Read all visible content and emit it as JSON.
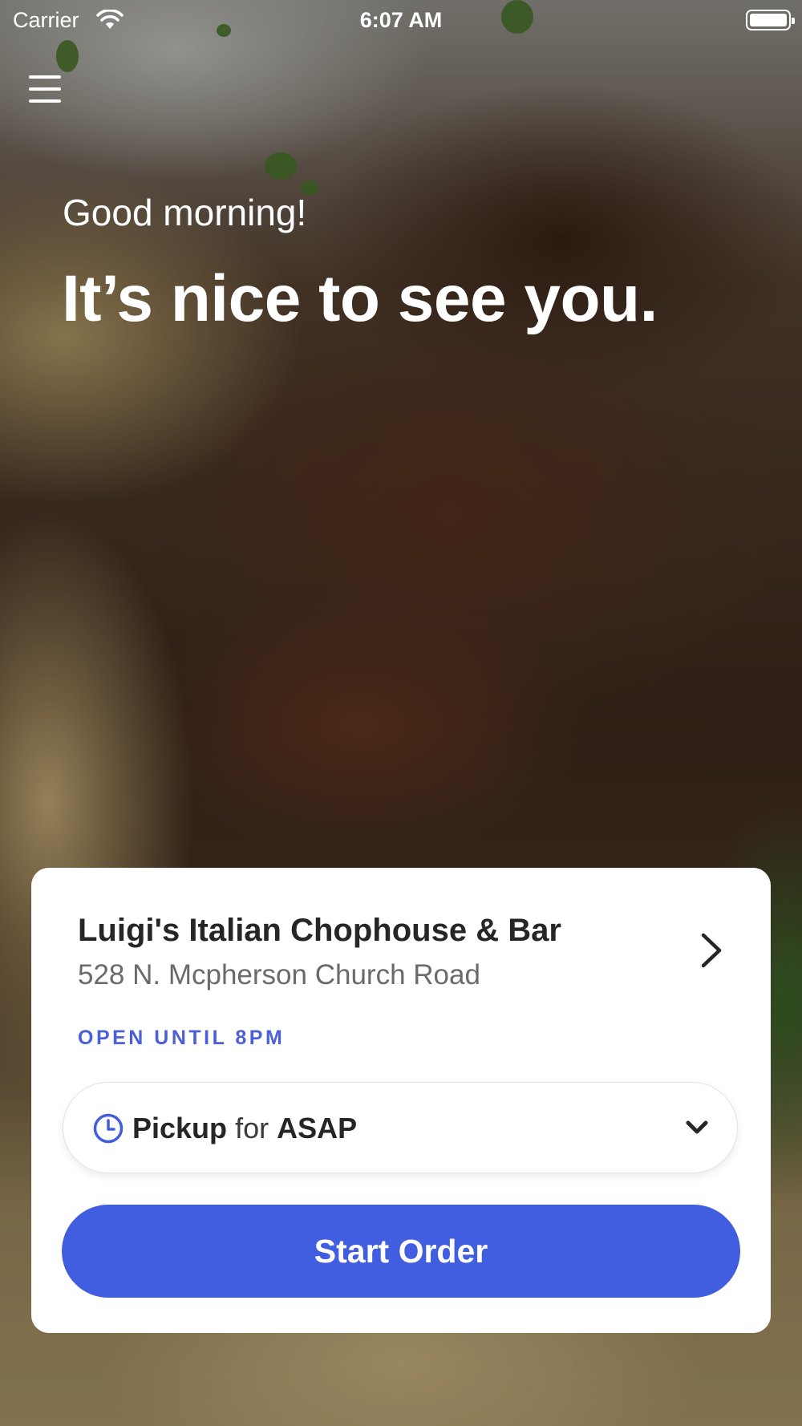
{
  "status_bar": {
    "carrier": "Carrier",
    "time": "6:07 AM"
  },
  "header": {
    "menu_icon": "hamburger-menu-icon"
  },
  "greeting": {
    "subtitle": "Good morning!",
    "title": "It’s nice to see you."
  },
  "location": {
    "name": "Luigi's Italian Chophouse & Bar",
    "address": "528 N. Mcpherson Church Road",
    "hours": "OPEN UNTIL 8PM",
    "chevron_icon": "chevron-right-icon"
  },
  "order_mode": {
    "mode": "Pickup",
    "connector": "for",
    "time": "ASAP",
    "icon": "clock-icon",
    "dropdown_icon": "chevron-down-icon"
  },
  "actions": {
    "start_order": "Start Order"
  },
  "colors": {
    "accent": "#415de0",
    "hours_text": "#4a5fd8"
  }
}
